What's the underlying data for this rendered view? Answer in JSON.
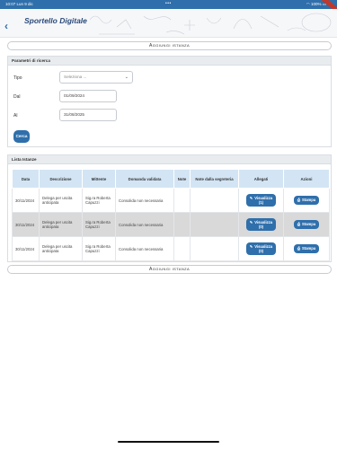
{
  "status_bar": {
    "time": "10:07",
    "date": "Lun 9 dic",
    "battery": "100%",
    "dots": "•••"
  },
  "header": {
    "title": "Sportello Digitale"
  },
  "add_button_label": "Aggiungi istanza",
  "search_panel": {
    "title": "Parametri di ricerca",
    "tipo_label": "Tipo",
    "tipo_placeholder": "Seleziona ...",
    "dal_label": "Dal",
    "dal_value": "01/09/2024",
    "al_label": "Al",
    "al_value": "31/08/2025",
    "cerca_label": "Cerca"
  },
  "list_panel": {
    "title": "Lista Istanze",
    "columns": [
      "Data",
      "Descrizione",
      "Mittente",
      "Domanda validata",
      "Note",
      "Note dalla segreteria",
      "Allegati",
      "Azioni"
    ],
    "rows": [
      {
        "data": "30/11/2024",
        "descrizione": "Delega per uscita anticipata",
        "mittente": "Sig.ra Roberta Capuzzi",
        "domanda": "Consolida non necessaria",
        "note": "",
        "note_segreteria": "",
        "allegati": "Visualizza (1)",
        "azione": "Stampa"
      },
      {
        "data": "30/11/2024",
        "descrizione": "Delega per uscita anticipata",
        "mittente": "Sig.ra Roberta Capuzzi",
        "domanda": "Consolida non necessaria",
        "note": "",
        "note_segreteria": "",
        "allegati": "Visualizza (0)",
        "azione": "Stampa"
      },
      {
        "data": "30/11/2024",
        "descrizione": "Delega per uscita anticipata",
        "mittente": "Sig.ra Roberta Capuzzi",
        "domanda": "Consolida non necessaria",
        "note": "",
        "note_segreteria": "",
        "allegati": "Visualizza (0)",
        "azione": "Stampa"
      }
    ]
  },
  "colors": {
    "accent": "#2f6fab",
    "table_header": "#d3e5f4",
    "panel_header": "#e9ecef"
  }
}
